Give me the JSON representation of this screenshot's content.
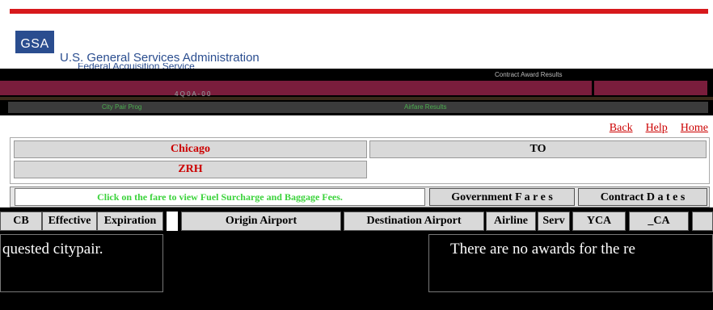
{
  "header": {
    "logo_text": "GSA",
    "agency_name": "U.S. General Services Administration",
    "sub_agency": "Federal Acquisition Service",
    "header_code": "4 Q 0 A  -  0 0",
    "header_left_link": "City Pair Prog",
    "header_right_text": "Contract Award Results",
    "header_center_link": "Airfare Results",
    "colors": {
      "top_bar": "#d7191c",
      "logo": "#2a4d8f",
      "header_band": "#7a1d3c"
    }
  },
  "nav": {
    "back": "Back",
    "help": "Help",
    "home": "Home"
  },
  "route": {
    "origin": "Chicago",
    "to_label": "TO",
    "destination": "ZRH"
  },
  "instructions": {
    "click_note": "Click on the fare to view Fuel Surcharge and Baggage Fees."
  },
  "tabs": {
    "government_fares": "Government  F a r e s",
    "contract_dates": "Contract  D a t e s"
  },
  "results_table": {
    "columns": [
      "CB",
      "Effective",
      "Expiration",
      "Origin Airport",
      "Destination Airport",
      "Airline",
      "Serv",
      "YCA",
      "_CA"
    ]
  },
  "messages": {
    "left_fragment": "quested citypair.",
    "right_fragment": "There are no awards for the re"
  }
}
